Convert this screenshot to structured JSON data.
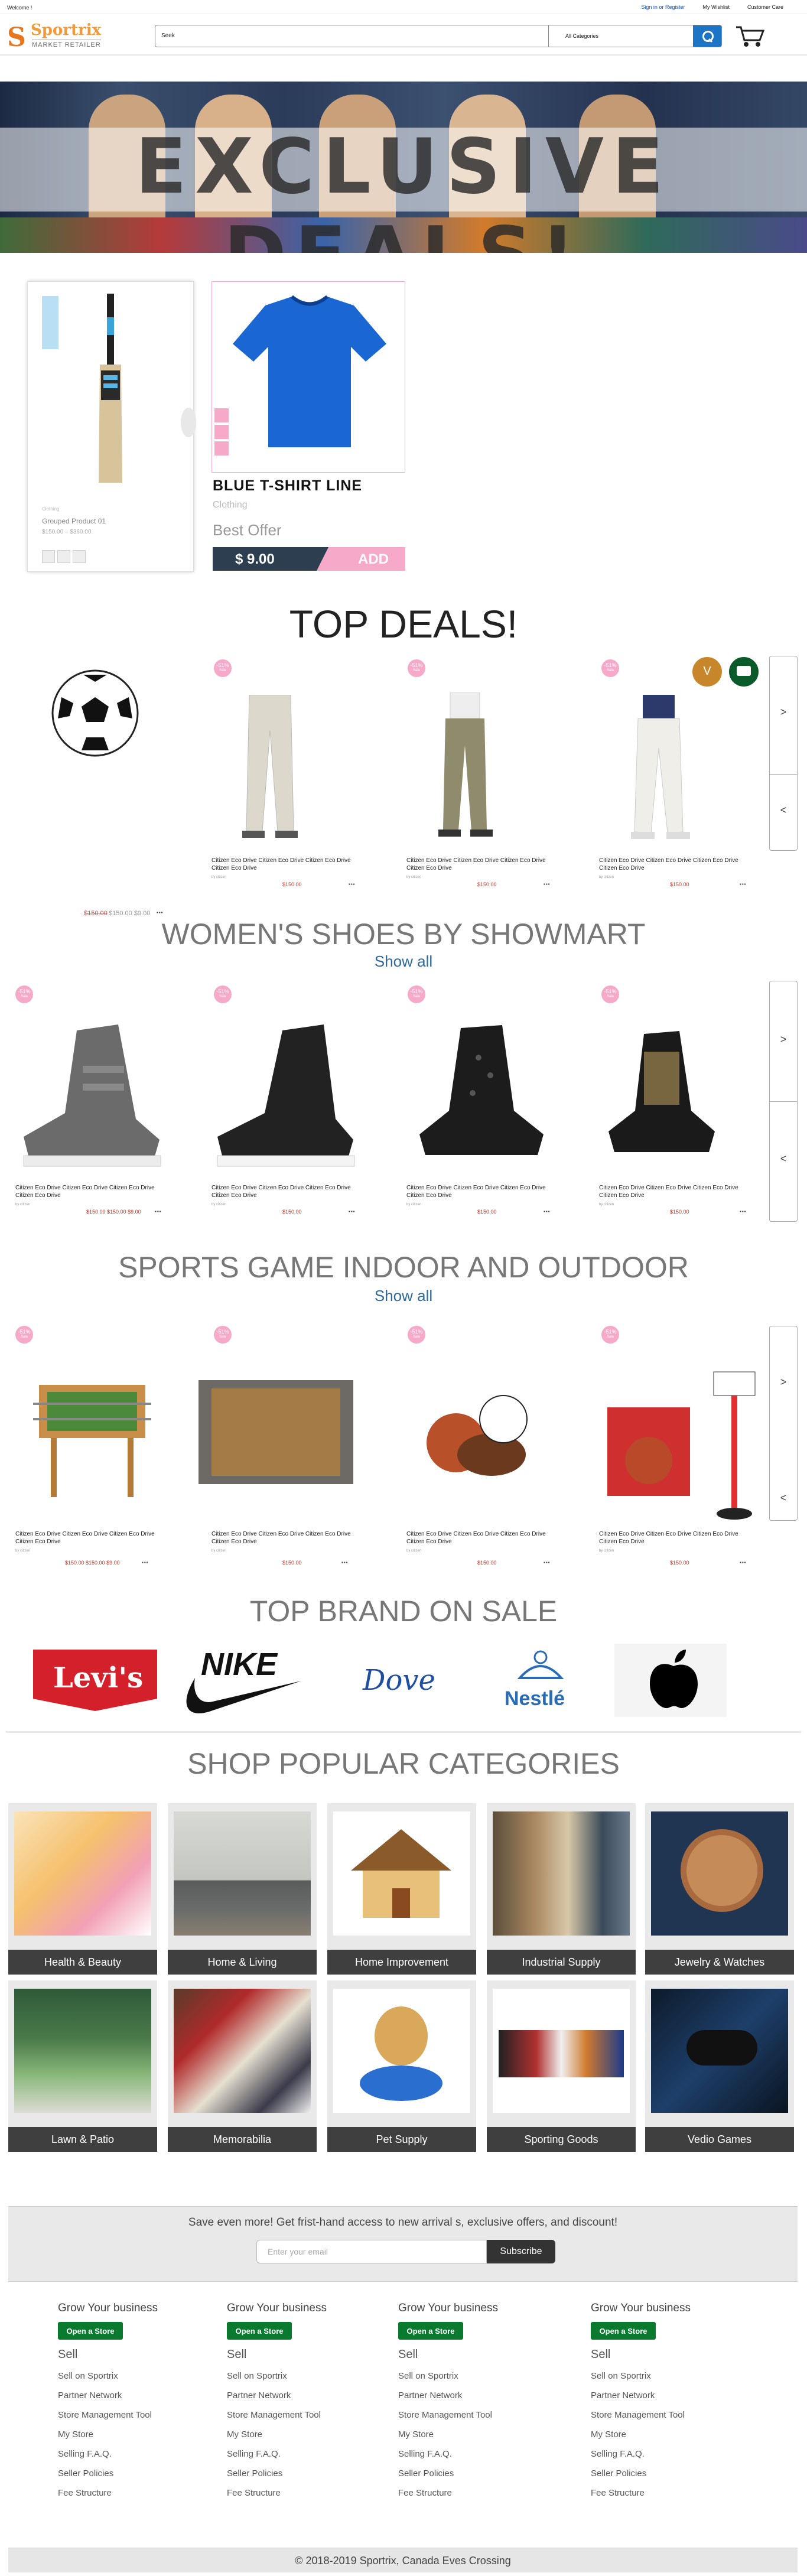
{
  "topbar": {
    "welcome": "Welcome !",
    "signin": "Sign in or Register",
    "wishlist": "My Wishlist",
    "customer_care": "Customer Care"
  },
  "header": {
    "logo_name": "Sportrix",
    "logo_sub": "MARKET RETAILER",
    "search_value": "Seek",
    "category": "All Categories"
  },
  "hero": {
    "text": "EXCLUSIVE DEALS!"
  },
  "featured": {
    "product1": {
      "name": "Grouped Product 01",
      "price": "$150.00 – $360.00",
      "category_small": "Clothing"
    },
    "product2": {
      "name": "BLUE T-SHIRT LINE",
      "category": "Clothing",
      "offer": "Best Offer",
      "price": "$ 9.00",
      "add": "ADD"
    }
  },
  "top_deals": {
    "title": "TOP DEALS!",
    "first_price": {
      "old": "$150.00",
      "range": "$150.00 $9.00"
    },
    "products": [
      {
        "name": "Citizen Eco Drive Citizen Eco Drive Citizen Eco Drive Citizen Eco Drive",
        "by": "by citizen",
        "price": "$150.00",
        "badge": "-51%",
        "badge_sub": "Sale"
      },
      {
        "name": "Citizen Eco Drive Citizen Eco Drive Citizen Eco Drive Citizen Eco Drive",
        "by": "by citizen",
        "price": "$150.00",
        "badge": "-51%",
        "badge_sub": "Sale"
      },
      {
        "name": "Citizen Eco Drive Citizen Eco Drive Citizen Eco Drive Citizen Eco Drive",
        "by": "by citizen",
        "price": "$150.00",
        "badge": "-51%",
        "badge_sub": "Sale"
      }
    ],
    "avatar_letter": "V"
  },
  "womens": {
    "title": "WOMEN'S SHOES BY SHOWMART",
    "show_all": "Show all",
    "products": [
      {
        "name": "Citizen Eco Drive Citizen Eco Drive Citizen Eco Drive Citizen Eco Drive",
        "by": "by citizen",
        "price": "$150.00 $150.00 $9.00",
        "badge": "-51%",
        "badge_sub": "Sale"
      },
      {
        "name": "Citizen Eco Drive Citizen Eco Drive Citizen Eco Drive Citizen Eco Drive",
        "by": "by citizen",
        "price": "$150.00",
        "badge": "-51%",
        "badge_sub": "Sale"
      },
      {
        "name": "Citizen Eco Drive Citizen Eco Drive Citizen Eco Drive Citizen Eco Drive",
        "by": "by citizen",
        "price": "$150.00",
        "badge": "-51%",
        "badge_sub": "Sale"
      },
      {
        "name": "Citizen Eco Drive Citizen Eco Drive Citizen Eco Drive Citizen Eco Drive",
        "by": "by citizen",
        "price": "$150.00",
        "badge": "-51%",
        "badge_sub": "Sale"
      }
    ]
  },
  "sports": {
    "title": "SPORTS GAME INDOOR AND OUTDOOR",
    "show_all": "Show all",
    "products": [
      {
        "name": "Citizen Eco Drive Citizen Eco Drive Citizen Eco Drive Citizen Eco Drive",
        "by": "by citizen",
        "price": "$150.00 $150.00 $9.00",
        "badge": "-51%",
        "badge_sub": "Sale"
      },
      {
        "name": "Citizen Eco Drive Citizen Eco Drive Citizen Eco Drive Citizen Eco Drive",
        "by": "by citizen",
        "price": "$150.00",
        "badge": "-51%",
        "badge_sub": "Sale"
      },
      {
        "name": "Citizen Eco Drive Citizen Eco Drive Citizen Eco Drive Citizen Eco Drive",
        "by": "by citizen",
        "price": "$150.00",
        "badge": "-51%",
        "badge_sub": "Sale"
      },
      {
        "name": "Citizen Eco Drive Citizen Eco Drive Citizen Eco Drive Citizen Eco Drive",
        "by": "by citizen",
        "price": "$150.00",
        "badge": "-51%",
        "badge_sub": "Sale"
      }
    ]
  },
  "brands": {
    "title": "TOP BRAND ON SALE",
    "items": [
      {
        "name": "Levi's",
        "color": "#d4202b"
      },
      {
        "name": "NIKE",
        "color": "#111111"
      },
      {
        "name": "Dove",
        "color": "#1f4fa0"
      },
      {
        "name": "Nestlé",
        "color": "#2a6cb3"
      },
      {
        "name": "apple-logo-icon",
        "color": "#000000"
      }
    ]
  },
  "categories": {
    "title": "SHOP POPULAR CATEGORIES",
    "items": [
      "Health & Beauty",
      "Home & Living",
      "Home Improvement",
      "Industrial Supply",
      "Jewelry & Watches",
      "Lawn & Patio",
      "Memorabilia",
      "Pet Supply",
      "Sporting Goods",
      "Vedio Games"
    ]
  },
  "newsletter": {
    "text": "Save even more! Get frist-hand access to new arrival s, exclusive offers, and discount!",
    "placeholder": "Enter your email",
    "button": "Subscribe"
  },
  "footer": {
    "columns": [
      {
        "heading": "Grow Your business",
        "button": "Open a Store",
        "sell": "Sell"
      },
      {
        "heading": "Grow Your business",
        "button": "Open a Store",
        "sell": "Sell"
      },
      {
        "heading": "Grow Your business",
        "button": "Open a Store",
        "sell": "Sell"
      },
      {
        "heading": "Grow Your business",
        "button": "Open a Store",
        "sell": "Sell"
      }
    ],
    "links": [
      "Sell on Sportrix",
      "Partner Network",
      "Store Management Tool",
      "My Store",
      "Selling F.A.Q.",
      "Seller Policies",
      "Fee Structure"
    ],
    "copyright": "© 2018-2019 Sportrix, Canada Eves Crossing"
  },
  "colors": {
    "accent": "#1b74c4",
    "sale_pink": "#f6a9c9",
    "dark_band": "#3f3f3f",
    "open_store": "#0a7a2f"
  }
}
